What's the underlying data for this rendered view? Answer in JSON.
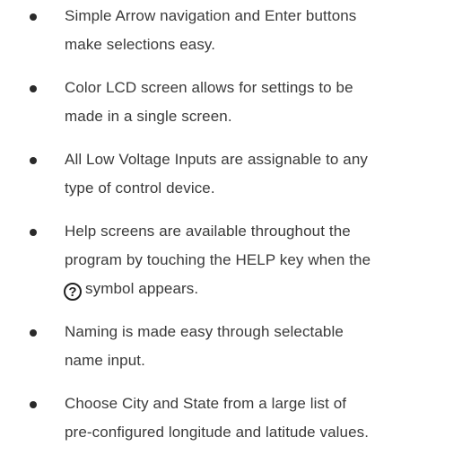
{
  "features": [
    {
      "line1": "Simple Arrow navigation and Enter buttons",
      "line2": "make selections easy."
    },
    {
      "line1": "Color LCD screen allows for settings to be",
      "line2": "made in a single screen."
    },
    {
      "line1": "All Low Voltage Inputs are assignable to any",
      "line2": "type of control device."
    },
    {
      "line1": "Help screens are available throughout the",
      "line2": "program by touching the HELP key when the",
      "line3_icon_glyph": "?",
      "line3_text": "symbol appears."
    },
    {
      "line1": "Naming is made easy through selectable",
      "line2": "name input."
    },
    {
      "line1": "Choose City and State from a large list of",
      "line2": "pre-configured longitude and latitude values."
    }
  ],
  "icons": {
    "help": "help-icon"
  }
}
